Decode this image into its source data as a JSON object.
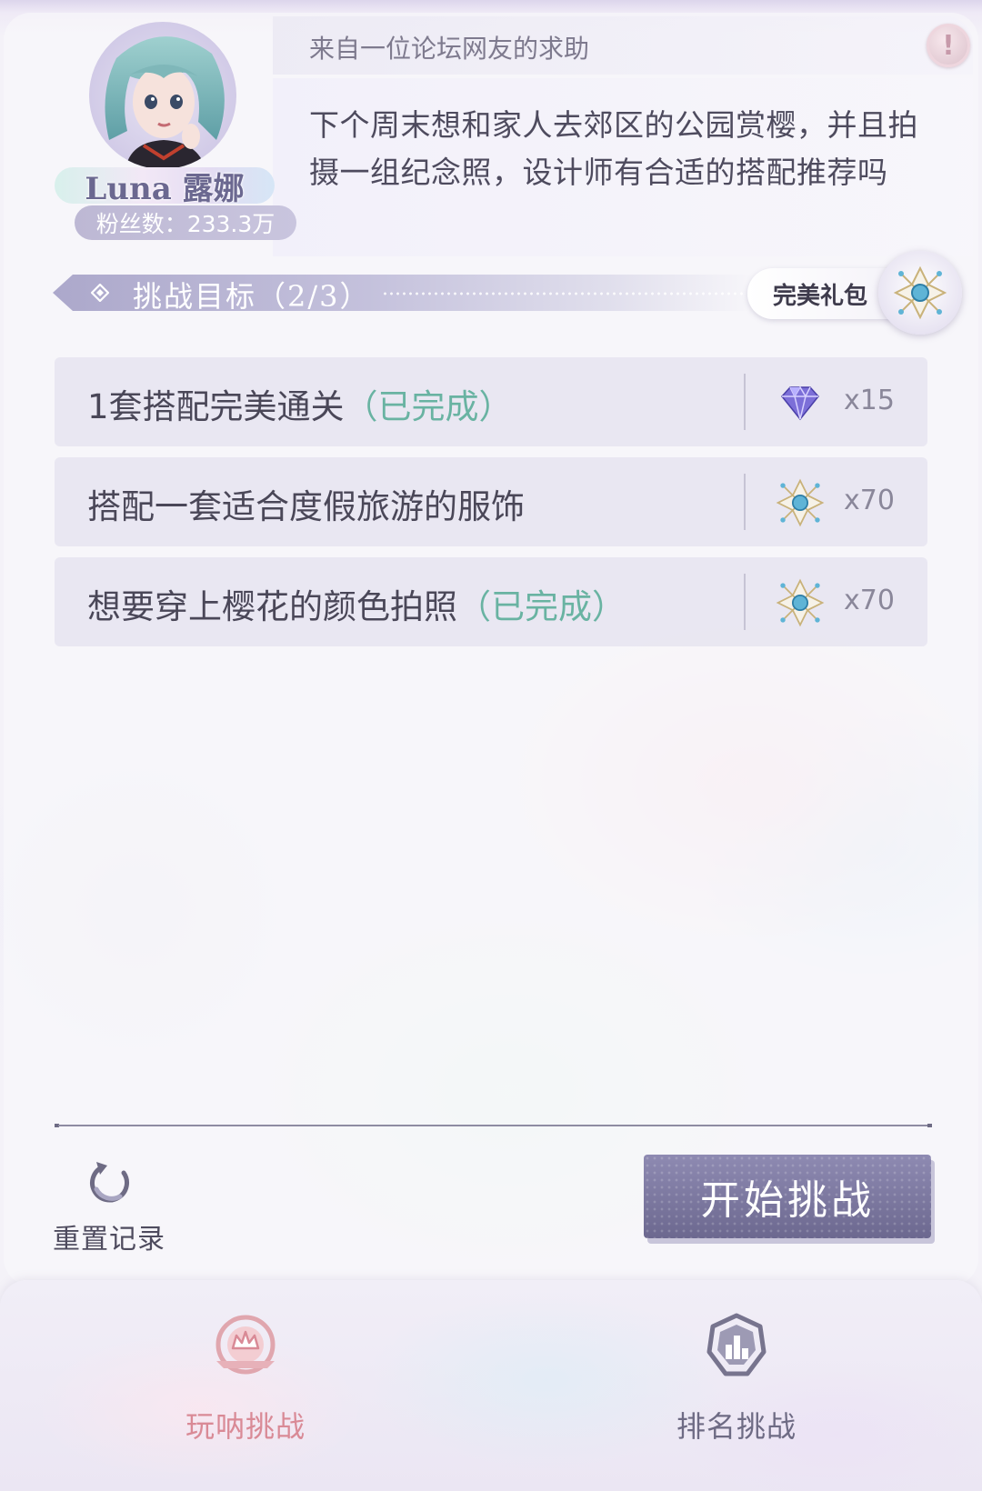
{
  "header": {
    "source_label": "来自一位论坛网友的求助",
    "request_text": "下个周末想和家人去郊区的公园赏樱，并且拍摄一组纪念照，设计师有合适的搭配推荐吗",
    "alert_icon": "!",
    "user": {
      "name": "Luna 露娜",
      "fans": "粉丝数：233.3万"
    }
  },
  "goals": {
    "title": "挑战目标（2/3）",
    "gift_label": "完美礼包",
    "gift_icon": "compass-star-icon",
    "tasks": [
      {
        "text": "1套搭配完美通关",
        "status": "（已完成）",
        "reward_icon": "diamond-icon",
        "reward_count": "x15"
      },
      {
        "text": "搭配一套适合度假旅游的服饰",
        "status": "",
        "reward_icon": "compass-star-icon",
        "reward_count": "x70"
      },
      {
        "text": "想要穿上樱花的颜色拍照",
        "status": "（已完成）",
        "reward_icon": "compass-star-icon",
        "reward_count": "x70"
      }
    ]
  },
  "controls": {
    "reset_label": "重置记录",
    "start_label": "开始挑战"
  },
  "tabs": [
    {
      "label": "玩呐挑战",
      "icon": "crown-badge-icon",
      "active": true,
      "color": "#d98a96"
    },
    {
      "label": "排名挑战",
      "icon": "ranking-badge-icon",
      "active": false,
      "color": "#6e6b84"
    }
  ],
  "colors": {
    "accent": "#8c88b0",
    "completed": "#69b3a2",
    "active_tab": "#d98a96"
  }
}
